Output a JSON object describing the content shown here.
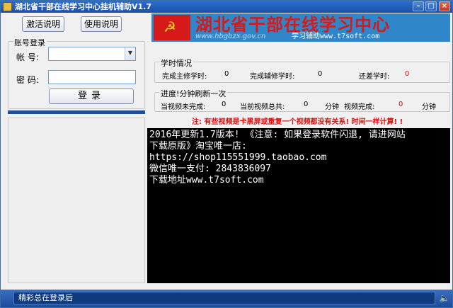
{
  "window": {
    "title": "湖北省干部在线学习中心挂机辅助V1.7",
    "minimize_glyph": "–",
    "maximize_glyph": "□",
    "close_glyph": "×"
  },
  "toolbar": {
    "activate_label": "激活说明",
    "usage_label": "使用说明"
  },
  "login": {
    "group_title": "账号登录",
    "account_label": "帐  号:",
    "password_label": "密  码:",
    "account_value": "",
    "password_value": "",
    "login_label": "登录",
    "dropdown_glyph": "▼"
  },
  "banner": {
    "emblem_glyph": "☭",
    "title": "湖北省干部在线学习中心",
    "url": "www.hbgbzx.gov.cn",
    "assist": "学习辅助www.t7soft.com"
  },
  "study": {
    "group_title": "学时情况",
    "required_label": "完成主修学时:",
    "required_value": "0",
    "elective_label": "完成辅修学时:",
    "elective_value": "0",
    "remaining_label": "还差学时:",
    "remaining_value": "0"
  },
  "progress": {
    "group_title": "进度!分钟刷新一次",
    "unfinished_label": "当视频未完成:",
    "unfinished_value": "0",
    "total_label": "当前视频总共:",
    "total_value": "0",
    "total_unit": "分钟",
    "done_label": "视频完成:",
    "done_value": "0",
    "done_unit": "分钟"
  },
  "notice": "注: 有些视频是卡黑屏或重复一个视频都没有关系! 时间一样计算! !",
  "console_lines": [
    "2016年更新1.7版本! 《注意: 如果登录软件闪退, 请进网站",
    "下载原版》淘宝唯一店:",
    "https://shop115551999.taobao.com",
    "微信唯一支付: 2843836097",
    "下载地址www.t7soft.com"
  ],
  "status": {
    "text": "精彩总在登录后",
    "speaker_glyph": "🔈"
  },
  "colors": {
    "titlebar": "#1a4fa8",
    "banner_bg": "#2f86c8",
    "banner_title": "#d61a1a",
    "notice": "#e01010",
    "console_bg": "#000000"
  }
}
